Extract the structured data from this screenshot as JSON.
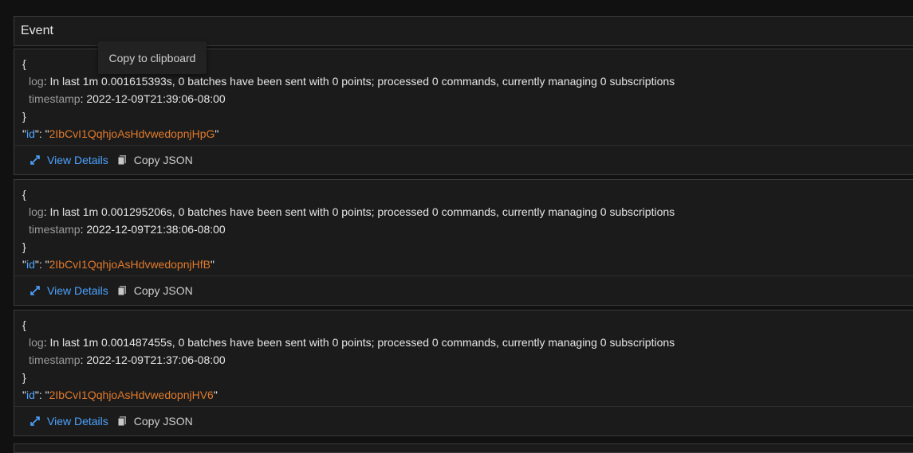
{
  "header": {
    "title": "Event"
  },
  "tooltip": {
    "text": "Copy to clipboard"
  },
  "events": [
    {
      "open_brace": "{",
      "close_brace": "}",
      "log_key": "log",
      "log_value": "In last 1m 0.001615393s, 0 batches have been sent with 0 points; processed 0 commands, currently managing 0 subscriptions",
      "timestamp_key": "timestamp",
      "timestamp_value": "2022-12-09T21:39:06-08:00",
      "id_key": "id",
      "id_value": "2IbCvI1QqhjoAsHdvwedopnjHpG"
    },
    {
      "open_brace": "{",
      "close_brace": "}",
      "log_key": "log",
      "log_value": "In last 1m 0.001295206s, 0 batches have been sent with 0 points; processed 0 commands, currently managing 0 subscriptions",
      "timestamp_key": "timestamp",
      "timestamp_value": "2022-12-09T21:38:06-08:00",
      "id_key": "id",
      "id_value": "2IbCvI1QqhjoAsHdvwedopnjHfB"
    },
    {
      "open_brace": "{",
      "close_brace": "}",
      "log_key": "log",
      "log_value": "In last 1m 0.001487455s, 0 batches have been sent with 0 points; processed 0 commands, currently managing 0 subscriptions",
      "timestamp_key": "timestamp",
      "timestamp_value": "2022-12-09T21:37:06-08:00",
      "id_key": "id",
      "id_value": "2IbCvI1QqhjoAsHdvwedopnjHV6"
    }
  ],
  "actions": {
    "view_details": "View Details",
    "copy_json": "Copy JSON"
  },
  "icons": {
    "details": "expand-icon",
    "copy": "copy-icon"
  },
  "colors": {
    "link": "#4da3ff",
    "id_value": "#e07a2c",
    "key": "#9b9b9b"
  }
}
